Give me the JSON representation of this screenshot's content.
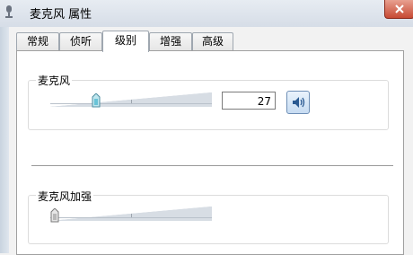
{
  "window": {
    "title": "麦克风 属性"
  },
  "tabs": [
    {
      "label": "常规"
    },
    {
      "label": "侦听"
    },
    {
      "label": "级别",
      "active": true
    },
    {
      "label": "增强"
    },
    {
      "label": "高级"
    }
  ],
  "levels": {
    "microphone": {
      "label": "麦克风",
      "value": "27",
      "level_percent": 27
    },
    "boost": {
      "label": "麦克风加强",
      "level_percent": 0
    }
  }
}
